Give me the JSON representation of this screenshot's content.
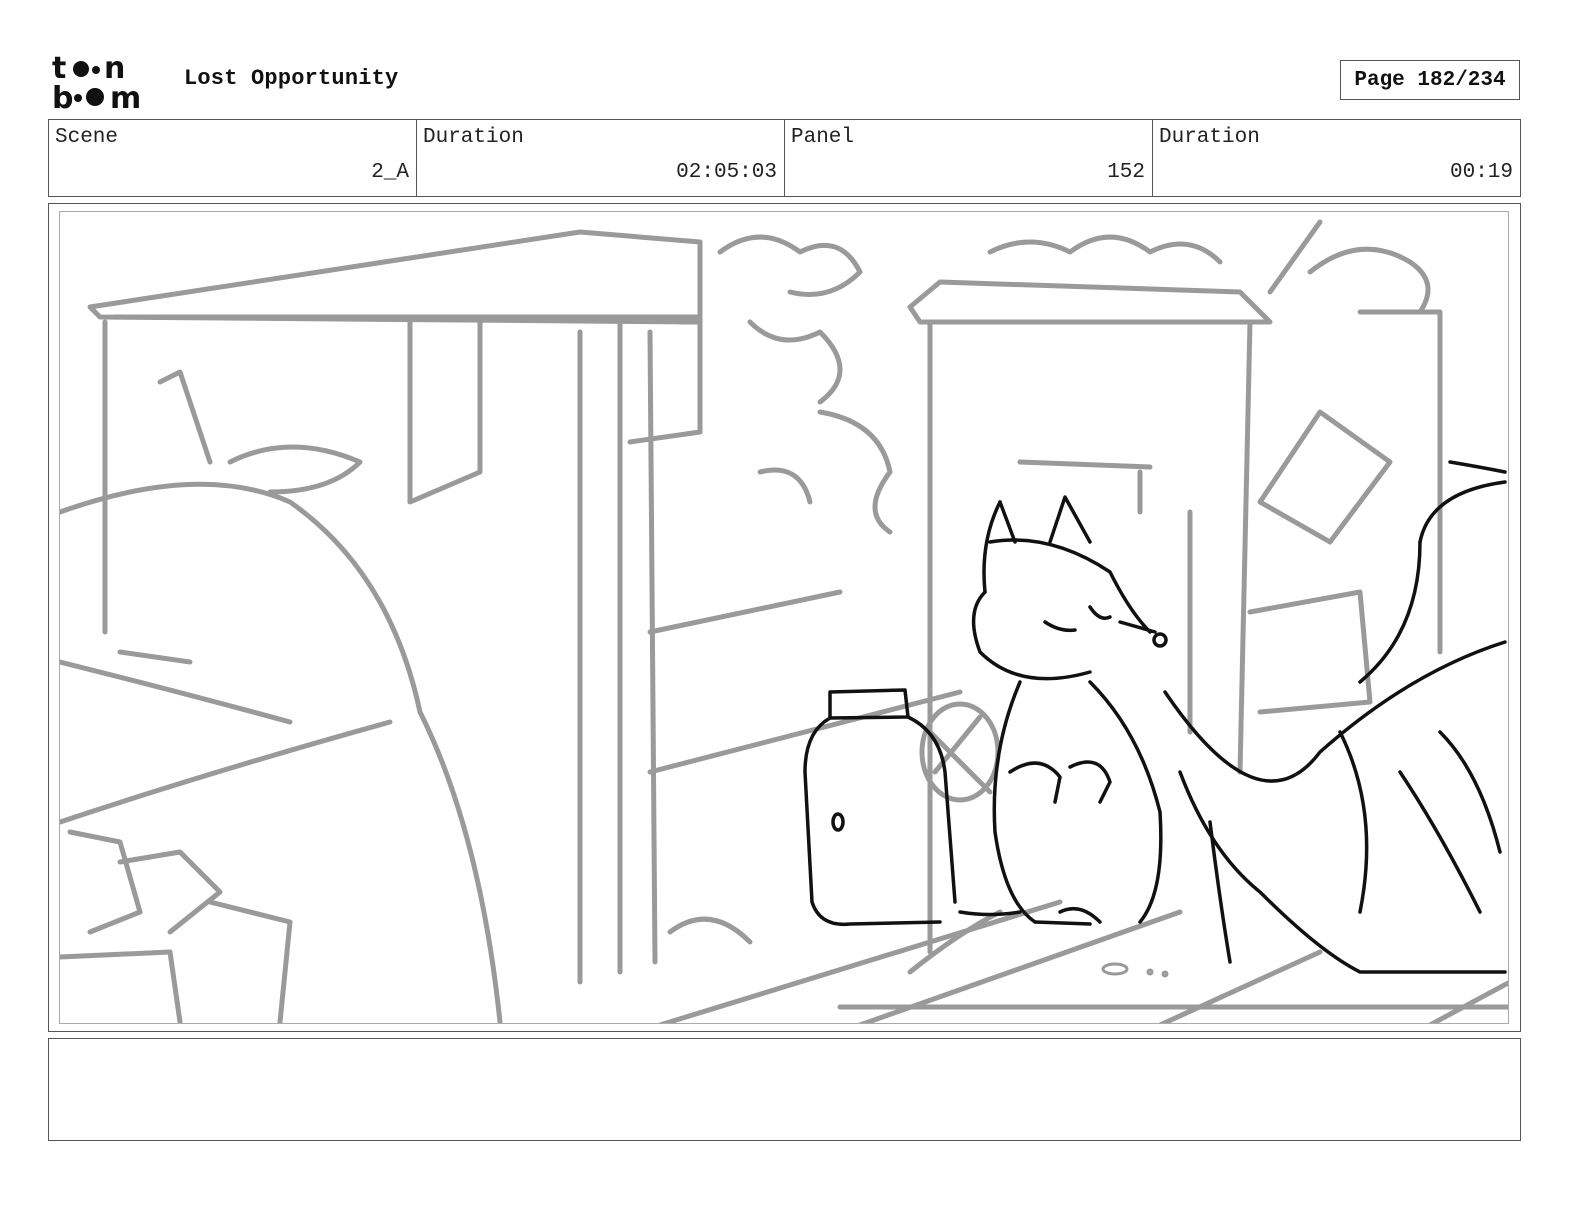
{
  "logo": {
    "brand_top": "toon",
    "brand_bottom": "boom"
  },
  "header": {
    "title": "Lost Opportunity",
    "page": "Page 182/234"
  },
  "info": {
    "scene_label": "Scene",
    "scene_value": "2_A",
    "scene_duration_label": "Duration",
    "scene_duration_value": "02:05:03",
    "panel_label": "Panel",
    "panel_value": "152",
    "panel_duration_label": "Duration",
    "panel_duration_value": "00:19"
  },
  "colors": {
    "sketch_gray": "#9a9a9a",
    "ink_black": "#111111",
    "border": "#555555"
  },
  "notes": {
    "text": ""
  }
}
